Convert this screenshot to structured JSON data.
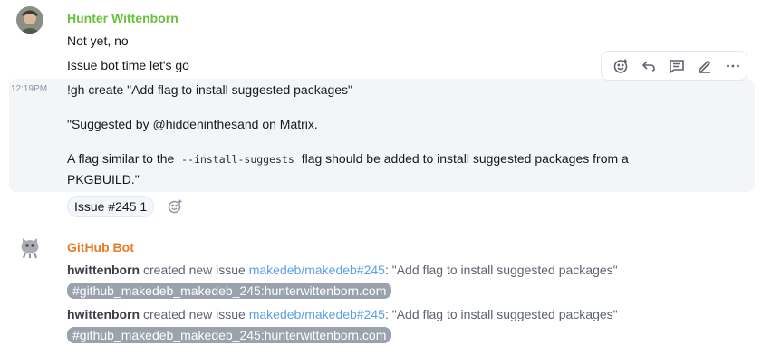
{
  "messages": {
    "group1": {
      "sender": "Hunter Wittenborn",
      "sender_color": "#68c23b",
      "lines": [
        "Not yet, no",
        "Issue bot time let's go"
      ]
    },
    "command": {
      "timestamp": "12:19PM",
      "line1": "!gh create \"Add flag to install suggested packages\"",
      "line2": "\"Suggested by @hiddeninthesand on Matrix.",
      "line3_before": "A flag similar to the",
      "line3_code": "--install-suggests",
      "line3_after": "flag should be added to install suggested packages from a",
      "line4": "PKGBUILD.\""
    },
    "reaction": {
      "label": "Issue #245 1"
    },
    "group2": {
      "sender": "GitHub Bot",
      "sender_color": "#e87b2a",
      "events": [
        {
          "user": "hwittenborn",
          "action": "created new issue",
          "repo_link": "makedeb/makedeb#245",
          "title": ": \"Add flag to install suggested packages\"",
          "room_pill": "#github_makedeb_makedeb_245:hunterwittenborn.com"
        },
        {
          "user": "hwittenborn",
          "action": "created new issue",
          "repo_link": "makedeb/makedeb#245",
          "title": ": \"Add flag to install suggested packages\"",
          "room_pill": "#github_makedeb_makedeb_245:hunterwittenborn.com"
        }
      ]
    }
  },
  "toolbar": {
    "icons": [
      "react-icon",
      "reply-icon",
      "thread-icon",
      "edit-icon",
      "options-icon"
    ]
  }
}
